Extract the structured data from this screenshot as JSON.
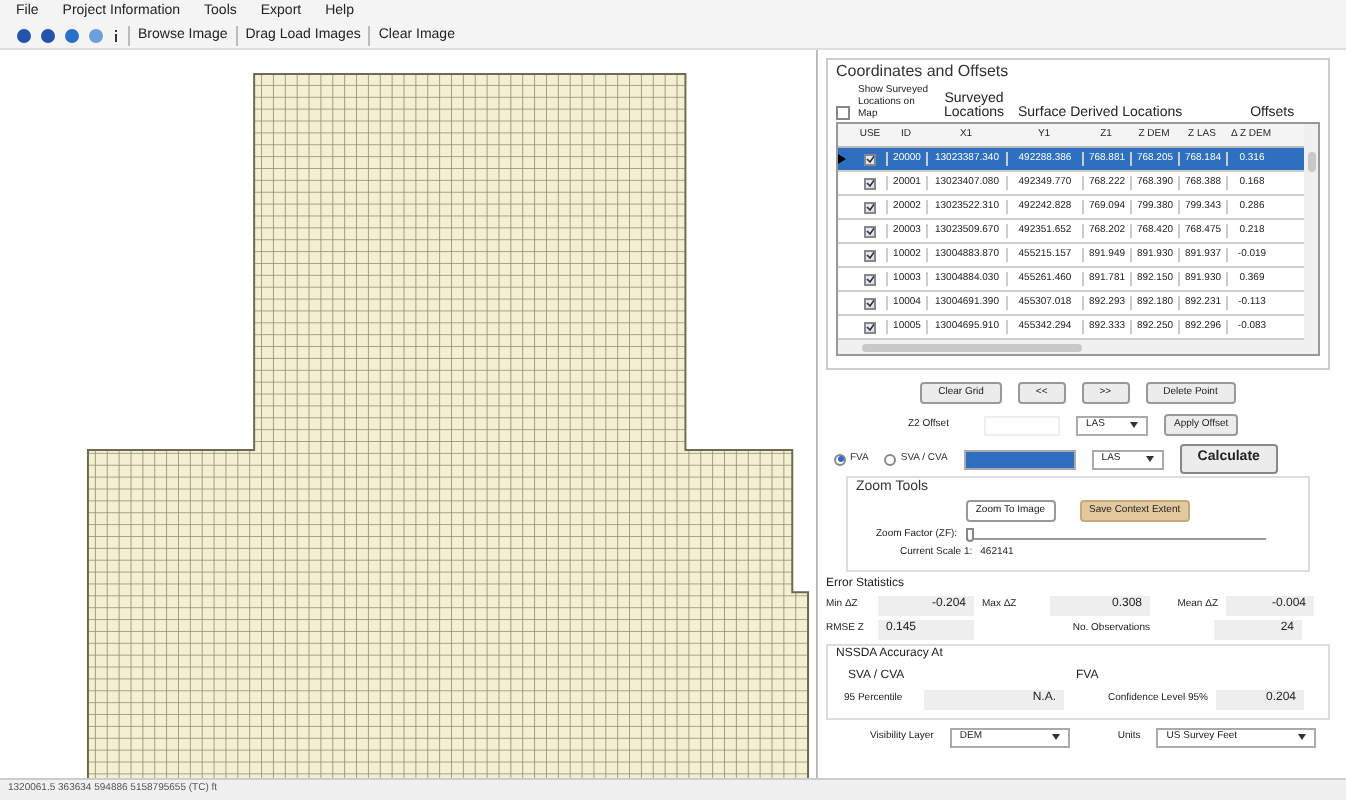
{
  "menu": [
    "File",
    "Project Information",
    "Tools",
    "Export",
    "Help"
  ],
  "toolbar": {
    "buttons": [
      "Browse Image",
      "Drag Load Images",
      "Clear Image"
    ]
  },
  "coordinates": {
    "title": "Coordinates and Offsets",
    "show_surveyed": {
      "label": "Show Surveyed Locations on Map",
      "checked": false
    },
    "group_headers": [
      "Surveyed Locations",
      "Surface Derived Locations",
      "Offsets"
    ],
    "use_column": "USE",
    "columns": [
      "ID",
      "X1",
      "Y1",
      "Z1",
      "Z DEM",
      "Z LAS",
      "Δ Z DEM"
    ],
    "rows": [
      {
        "selected": true,
        "use": true,
        "cells": [
          "20000",
          "13023387.340",
          "492288.386",
          "768.881",
          "768.205",
          "768.184",
          "0.316"
        ]
      },
      {
        "selected": false,
        "use": true,
        "cells": [
          "20001",
          "13023407.080",
          "492349.770",
          "768.222",
          "768.390",
          "768.388",
          "0.168"
        ]
      },
      {
        "selected": false,
        "use": true,
        "cells": [
          "20002",
          "13023522.310",
          "492242.828",
          "769.094",
          "799.380",
          "799.343",
          "0.286"
        ]
      },
      {
        "selected": false,
        "use": true,
        "cells": [
          "20003",
          "13023509.670",
          "492351.652",
          "768.202",
          "768.420",
          "768.475",
          "0.218"
        ]
      },
      {
        "selected": false,
        "use": true,
        "cells": [
          "10002",
          "13004883.870",
          "455215.157",
          "891.949",
          "891.930",
          "891.937",
          "-0.019"
        ]
      },
      {
        "selected": false,
        "use": true,
        "cells": [
          "10003",
          "13004884.030",
          "455261.460",
          "891.781",
          "892.150",
          "891.930",
          "0.369"
        ]
      },
      {
        "selected": false,
        "use": true,
        "cells": [
          "10004",
          "13004691.390",
          "455307.018",
          "892.293",
          "892.180",
          "892.231",
          "-0.113"
        ]
      },
      {
        "selected": false,
        "use": true,
        "cells": [
          "10005",
          "13004695.910",
          "455342.294",
          "892.333",
          "892.250",
          "892.296",
          "-0.083"
        ]
      }
    ]
  },
  "grid_buttons": [
    "Clear Grid",
    "<<",
    ">>",
    "Delete Point"
  ],
  "offset": {
    "label": "Z2 Offset",
    "layer": "LAS",
    "button": "Apply Offset"
  },
  "mode": {
    "options": [
      {
        "label": "FVA",
        "selected": true
      },
      {
        "label": "SVA / CVA",
        "selected": false
      }
    ],
    "layer": "LAS",
    "button": "Calculate"
  },
  "zoom_tools": {
    "title": "Zoom Tools",
    "zoom_button": "Zoom To Image",
    "save_button": "Save Context Extent",
    "factor_label": "Zoom Factor (ZF):",
    "level": 0.0,
    "scale_label": "Current Scale  1:",
    "scale": "462141"
  },
  "error_statistics": {
    "title": "Error Statistics",
    "min_label": "Min ΔZ",
    "min": "-0.204",
    "max_label": "Max ΔZ",
    "max": "0.308",
    "mean_label": "Mean ΔZ",
    "mean": "-0.004",
    "rmse_label": "RMSE Z",
    "rmse": "0.145",
    "obs_label": "No. Observations",
    "obs": "24"
  },
  "nssda": {
    "title": "NSSDA Accuracy At",
    "sva_title": "SVA / CVA",
    "fva_title": "FVA",
    "percentile_label": "95 Percentile",
    "percentile": "N.A.",
    "confidence_label": "Confidence Level 95%",
    "confidence": "0.204"
  },
  "bottom": {
    "visibility_label": "Visibility Layer",
    "visibility": "DEM",
    "units_label": "Units",
    "units": "US Survey Feet"
  },
  "status_bar": "1320061.5 363634 594886 5158795655 (TC) ft"
}
